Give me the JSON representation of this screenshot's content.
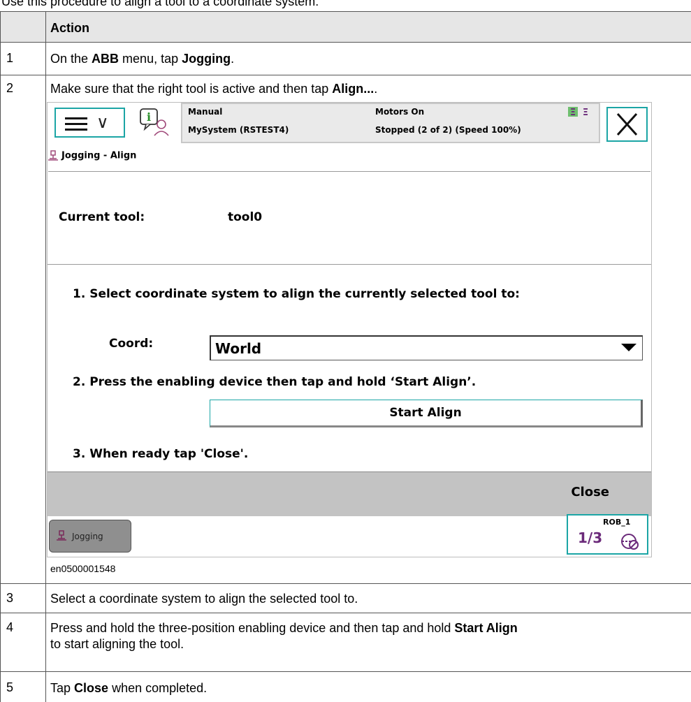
{
  "intro_text": "Use this procedure to align a tool to a coordinate system:",
  "table": {
    "header": {
      "num": "",
      "action": "Action"
    },
    "rows": [
      {
        "num": "1",
        "parts": [
          "On the ",
          "ABB",
          " menu, tap ",
          "Jogging",
          "."
        ]
      },
      {
        "num": "2",
        "parts": [
          "Make sure that the right tool is active and then tap ",
          "Align...",
          "."
        ]
      },
      {
        "num": "3",
        "parts": [
          "Select a coordinate system to align the selected tool to."
        ]
      },
      {
        "num": "4",
        "line1": [
          "Press and hold the three-position enabling device and then tap and hold ",
          "Start Align"
        ],
        "line2": "to start aligning the tool."
      },
      {
        "num": "5",
        "parts": [
          "Tap ",
          "Close",
          " when completed."
        ]
      }
    ]
  },
  "screen": {
    "status": {
      "mode": "Manual",
      "system": "MySystem (RSTEST4)",
      "motors": "Motors On",
      "state": "Stopped (2 of 2) (Speed 100%)"
    },
    "breadcrumb": "Jogging - Align",
    "current_tool_label": "Current tool:",
    "current_tool_value": "tool0",
    "step1": "1. Select coordinate system to align the currently selected tool to:",
    "coord_label": "Coord:",
    "coord_value": "World",
    "step2": "2. Press the enabling device then tap and hold ‘Start Align’.",
    "start_align": "Start Align",
    "step3": "3. When ready tap 'Close'.",
    "close": "Close",
    "taskbar_jogging": "Jogging",
    "rob_label": "ROB_1",
    "rob_fraction": "1/3"
  },
  "figure_caption": "en0500001548",
  "colors": {
    "accent": "#1ba5a5",
    "header_bg": "#e6e6e6",
    "command_bar": "#c3c3c3"
  }
}
